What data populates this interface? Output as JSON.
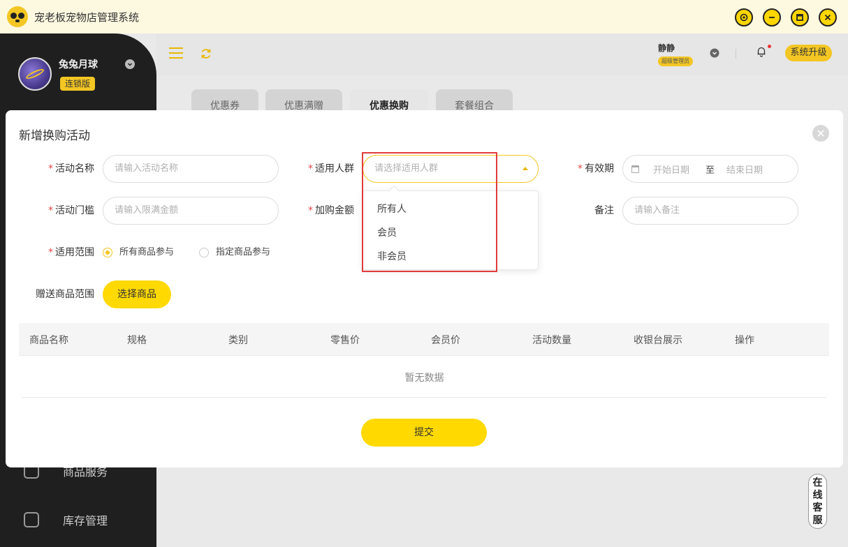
{
  "app": {
    "title": "宠老板宠物店管理系统"
  },
  "user": {
    "name": "兔兔月球",
    "edition": "连锁版"
  },
  "header": {
    "admin_name": "静静",
    "admin_role": "超级管理员",
    "upgrade_label": "系统升级"
  },
  "tabs": [
    "优惠券",
    "优惠满赠",
    "优惠换购",
    "套餐组合"
  ],
  "sidebar": {
    "items": [
      {
        "label": "商品服务"
      },
      {
        "label": "库存管理"
      }
    ]
  },
  "modal": {
    "title": "新增换购活动",
    "fields": {
      "name": {
        "label": "活动名称",
        "placeholder": "请输入活动名称"
      },
      "audience": {
        "label": "适用人群",
        "placeholder": "请选择适用人群"
      },
      "validity": {
        "label": "有效期",
        "start_placeholder": "开始日期",
        "separator": "至",
        "end_placeholder": "结束日期"
      },
      "threshold": {
        "label": "活动门槛",
        "placeholder": "请输入限满金额"
      },
      "add_amount": {
        "label": "加购金额"
      },
      "remark": {
        "label": "备注",
        "placeholder": "请输入备注"
      },
      "scope": {
        "label": "适用范围",
        "options": [
          "所有商品参与",
          "指定商品参与"
        ],
        "selected": "所有商品参与"
      },
      "gift_scope": {
        "label": "赠送商品范围",
        "button": "选择商品"
      }
    },
    "table": {
      "columns": [
        "商品名称",
        "规格",
        "类别",
        "零售价",
        "会员价",
        "活动数量",
        "收银台展示",
        "操作"
      ],
      "empty": "暂无数据"
    },
    "submit_label": "提交"
  },
  "dropdown": {
    "options": [
      "所有人",
      "会员",
      "非会员"
    ]
  },
  "service": {
    "label": "在线客服"
  },
  "colors": {
    "accent": "#ffd900",
    "highlight": "#e23b3b",
    "sidebar": "#1f1f1f"
  }
}
